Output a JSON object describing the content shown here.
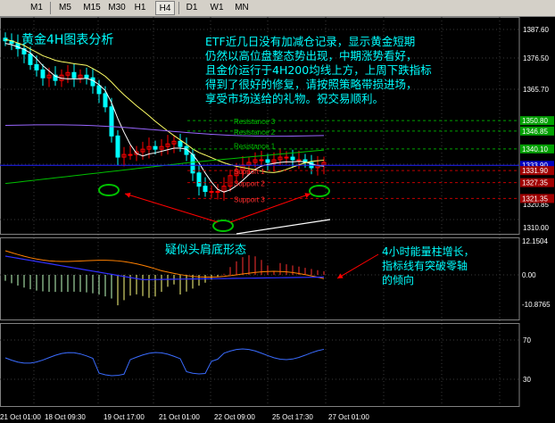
{
  "toolbar": {
    "buttons": [
      "M1",
      "M5",
      "M15",
      "M30",
      "H1",
      "H4",
      "D1",
      "W1",
      "MN"
    ],
    "active": "H4"
  },
  "colors": {
    "background": "#000000",
    "bull": "#ff0000",
    "bear": "#00ffff",
    "grid": "#3a3a3a",
    "annotation": "#00ffff",
    "resistance": "#00c000",
    "support": "#c00000",
    "circle": "#00c000",
    "arrow": "#ff0000"
  },
  "main_panel": {
    "title": "黄金4H图表分析",
    "commentary": [
      "ETF近几日没有加减仓记录，显示黄金短期",
      "仍然以高位盘整态势出现，中期涨势看好，",
      "且金价运行于4H200均线上方，上周下跌指标",
      "得到了很好的修复，请按照策略带损进场，",
      "享受市场送给的礼物。祝交易顺利。"
    ],
    "axis_labels": [
      "1387.60",
      "1376.50",
      "1365.70",
      "1320.85",
      "1310.00"
    ],
    "level_tags": [
      {
        "text": "1350.80",
        "bg": "#00a000"
      },
      {
        "text": "1346.85",
        "bg": "#00a000"
      },
      {
        "text": "1340.10",
        "bg": "#00a000"
      },
      {
        "text": "1333.90",
        "bg": "#0000c0"
      },
      {
        "text": "1331.90",
        "bg": "#a00000"
      },
      {
        "text": "1327.35",
        "bg": "#a00000"
      },
      {
        "text": "1321.35",
        "bg": "#a00000"
      }
    ],
    "line_labels": {
      "resistance3": "Resistance 3",
      "resistance2": "Resistance 2",
      "resistance1": "Resistance 1",
      "support1": "Support 1",
      "support2": "Support 2",
      "support3": "Support 3"
    }
  },
  "macd_panel": {
    "annotation": "疑似头肩底形态",
    "note": [
      "4小时能量柱增长，",
      "指标线有突破零轴",
      "的倾向"
    ],
    "axis_labels": [
      "12.1504",
      "0.00",
      "-10.8765"
    ]
  },
  "rsi_panel": {
    "axis_labels": [
      "70",
      "30"
    ]
  },
  "x_axis": [
    "21 Oct 01:00",
    "18 Oct 09:30",
    "19 Oct 17:00",
    "21 Oct 01:00",
    "22 Oct 09:00",
    "25 Oct 17:30",
    "27 Oct 01:00"
  ],
  "chart_data": {
    "type": "candlestick",
    "series": [
      {
        "name": "price",
        "values": [
          1381,
          1380,
          1378,
          1376,
          1372,
          1370,
          1367,
          1368,
          1366,
          1368,
          1369,
          1367,
          1368,
          1367,
          1364,
          1361,
          1356,
          1345,
          1337,
          1338,
          1338,
          1339,
          1340,
          1341,
          1340,
          1341,
          1342,
          1343,
          1341,
          1338,
          1331,
          1326,
          1324,
          1324,
          1324,
          1326,
          1330,
          1332,
          1334,
          1335,
          1336,
          1336,
          1335,
          1336,
          1337,
          1337,
          1336,
          1336,
          1335,
          1333,
          1334,
          1335
        ]
      }
    ]
  }
}
